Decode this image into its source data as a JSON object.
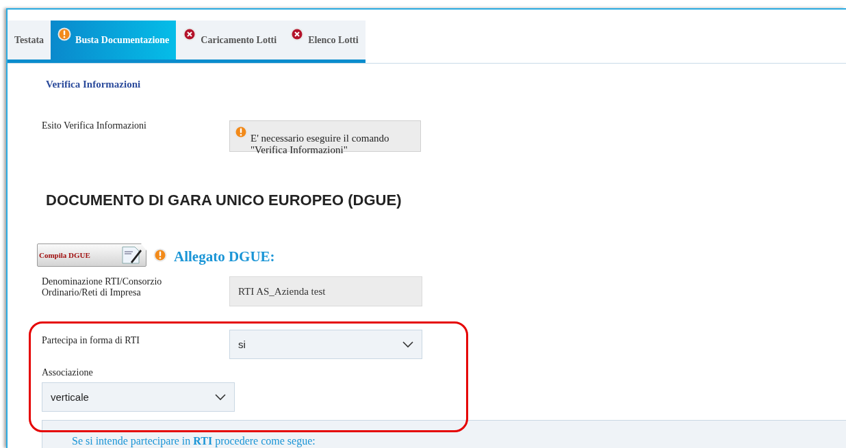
{
  "tabs": [
    {
      "label": "Testata",
      "selected": false,
      "warning": false,
      "error": false
    },
    {
      "label": "Busta Documentazione",
      "selected": true,
      "warning": true,
      "error": false
    },
    {
      "label": "Caricamento Lotti",
      "selected": false,
      "warning": false,
      "error": true
    },
    {
      "label": "Elenco Lotti",
      "selected": false,
      "warning": false,
      "error": true
    }
  ],
  "section_title": "Verifica Informazioni",
  "verify": {
    "label": "Esito Verifica Informazioni",
    "message": "E' necessario eseguire il comando \"Verifica Informazioni\"",
    "warning": true
  },
  "heading": "DOCUMENTO DI GARA UNICO EUROPEO (DGUE)",
  "dgue": {
    "button": "Compila DGUE",
    "warning": true,
    "title": "Allegato DGUE:"
  },
  "denominazione": {
    "label": "Denominazione RTI/Consorzio Ordinario/Reti di Impresa",
    "value": "RTI AS_Azienda test"
  },
  "partecipa": {
    "label": "Partecipa in forma di RTI",
    "value": "si"
  },
  "associazione": {
    "label": "Associazione",
    "value": "verticale"
  },
  "highlight": true,
  "info_panel": {
    "text": "Se si intende partecipare in **RTI** procedere come segue:"
  }
}
